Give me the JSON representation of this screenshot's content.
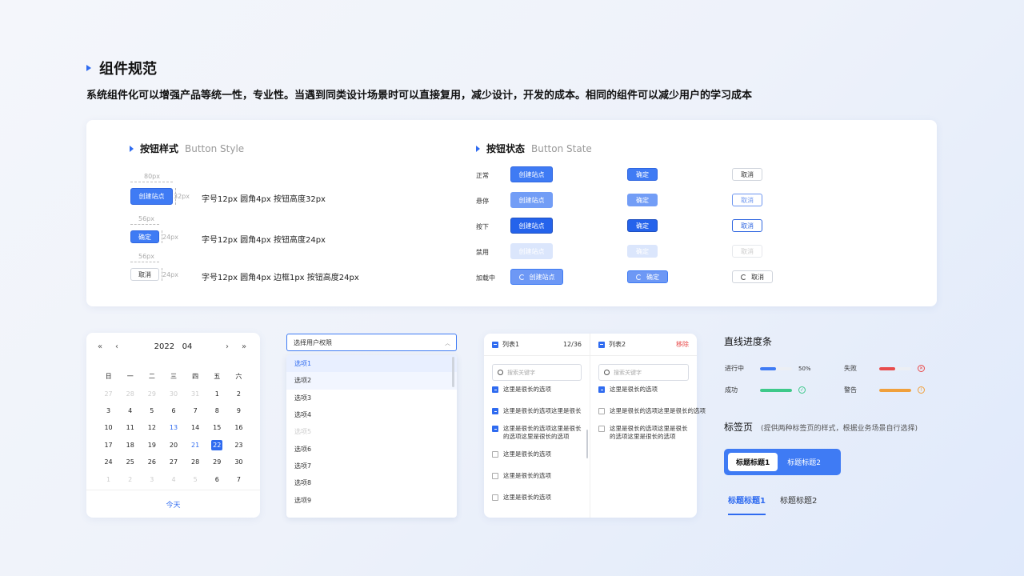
{
  "header": {
    "title": "组件规范",
    "description": "系统组件化可以增强产品等统一性，专业性。当遇到同类设计场景时可以直接复用，减少设计，开发的成本。相同的组件可以减少用户的学习成本"
  },
  "button_style": {
    "title": "按钮样式",
    "subtitle": "Button Style",
    "rows": [
      {
        "button": "创建站点",
        "width_label": "80px",
        "height_label": "32px",
        "spec": "字号12px   圆角4px   按钮高度32px"
      },
      {
        "button": "确定",
        "width_label": "56px",
        "height_label": "24px",
        "spec": "字号12px   圆角4px   按钮高度24px"
      },
      {
        "button": "取消",
        "width_label": "56px",
        "height_label": "24px",
        "spec": "字号12px   圆角4px   边框1px  按钮高度24px"
      }
    ]
  },
  "button_state": {
    "title": "按钮状态",
    "subtitle": "Button State",
    "states": [
      "正常",
      "悬停",
      "按下",
      "禁用",
      "加载中"
    ],
    "create_label": "创建站点",
    "confirm_label": "确定",
    "cancel_label": "取消"
  },
  "calendar": {
    "prev_year": "«",
    "prev_month": "‹",
    "next_month": "›",
    "next_year": "»",
    "year": "2022",
    "month": "04",
    "weekdays": [
      "日",
      "一",
      "二",
      "三",
      "四",
      "五",
      "六"
    ],
    "weeks": [
      [
        "27",
        "28",
        "29",
        "30",
        "31",
        "1",
        "2"
      ],
      [
        "3",
        "4",
        "5",
        "6",
        "7",
        "8",
        "9"
      ],
      [
        "10",
        "11",
        "12",
        "13",
        "14",
        "15",
        "16"
      ],
      [
        "17",
        "18",
        "19",
        "20",
        "21",
        "22",
        "23"
      ],
      [
        "24",
        "25",
        "26",
        "27",
        "28",
        "29",
        "30"
      ],
      [
        "1",
        "2",
        "3",
        "4",
        "5",
        "6",
        "7"
      ]
    ],
    "today_label": "今天"
  },
  "select": {
    "placeholder": "选择用户权限",
    "options": [
      "选项1",
      "选项2",
      "选项3",
      "选项4",
      "选项5",
      "选项6",
      "选项7",
      "选项8",
      "选项9"
    ]
  },
  "transfer": {
    "list1": {
      "title": "列表1",
      "count": "12/36",
      "search_placeholder": "搜索关键字",
      "items": [
        {
          "text": "这里是很长的选项",
          "checked": true
        },
        {
          "text": "这里是很长的选项这里是很长",
          "checked": true
        },
        {
          "text": "这里是很长的选项这里是很长的选项这里是很长的选项",
          "checked": true
        },
        {
          "text": "这里是很长的选项",
          "checked": false
        },
        {
          "text": "这里是很长的选项",
          "checked": false
        },
        {
          "text": "这里是很长的选项",
          "checked": false
        }
      ]
    },
    "list2": {
      "title": "列表2",
      "remove_label": "移除",
      "search_placeholder": "搜索关键字",
      "items": [
        {
          "text": "这里是很长的选项",
          "checked": true
        },
        {
          "text": "这里是很长的选项这里是很长的选项",
          "checked": false
        },
        {
          "text": "这里是很长的选项这里是很长的选项这里是很长的选项",
          "checked": false
        }
      ]
    }
  },
  "progress": {
    "title": "直线进度条",
    "items": [
      {
        "label": "进行中",
        "percent_text": "50%",
        "fill": 0.5,
        "color": "#3f7bf4"
      },
      {
        "label": "失败",
        "fill": 0.5,
        "color": "#e84c4c",
        "icon": "close-circle-icon"
      },
      {
        "label": "成功",
        "fill": 1.0,
        "color": "#3ec98a",
        "icon": "check-circle-icon"
      },
      {
        "label": "警告",
        "fill": 1.0,
        "color": "#f0a03c",
        "icon": "warning-circle-icon"
      }
    ]
  },
  "tabs": {
    "title": "标签页",
    "note": "(提供两种标签页的样式，根据业务场景自行选择)",
    "segment": [
      "标题标题1",
      "标题标题2"
    ],
    "line": [
      "标题标题1",
      "标题标题2"
    ]
  },
  "colors": {
    "primary": "#3f7bf4",
    "danger": "#e84c4c",
    "success": "#3ec98a",
    "warning": "#f0a03c"
  }
}
